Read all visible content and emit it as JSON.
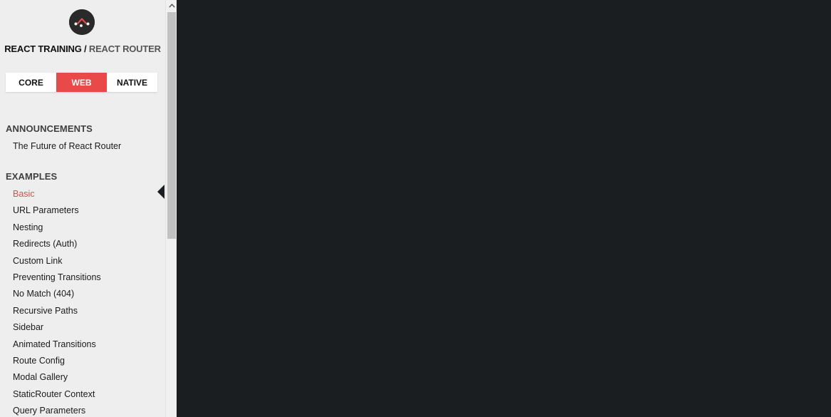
{
  "brand": {
    "primary": "REACT TRAINING /",
    "secondary": "REACT ROUTER"
  },
  "platform_tabs": [
    {
      "label": "CORE",
      "active": false
    },
    {
      "label": "WEB",
      "active": true
    },
    {
      "label": "NATIVE",
      "active": false
    }
  ],
  "announcements": {
    "heading": "ANNOUNCEMENTS",
    "items": [
      "The Future of React Router"
    ]
  },
  "examples": {
    "heading": "EXAMPLES",
    "active_item": "Basic",
    "items": [
      "Basic",
      "URL Parameters",
      "Nesting",
      "Redirects (Auth)",
      "Custom Link",
      "Preventing Transitions",
      "No Match (404)",
      "Recursive Paths",
      "Sidebar",
      "Animated Transitions",
      "Route Config",
      "Modal Gallery",
      "StaticRouter Context",
      "Query Parameters"
    ]
  },
  "colors": {
    "accent": "#e94949",
    "sidebar_bg": "#eeeeee",
    "main_bg": "#1b1e21"
  },
  "icons": {
    "logo": "react-router-logo-icon",
    "scroll_up": "chevron-up-icon"
  }
}
